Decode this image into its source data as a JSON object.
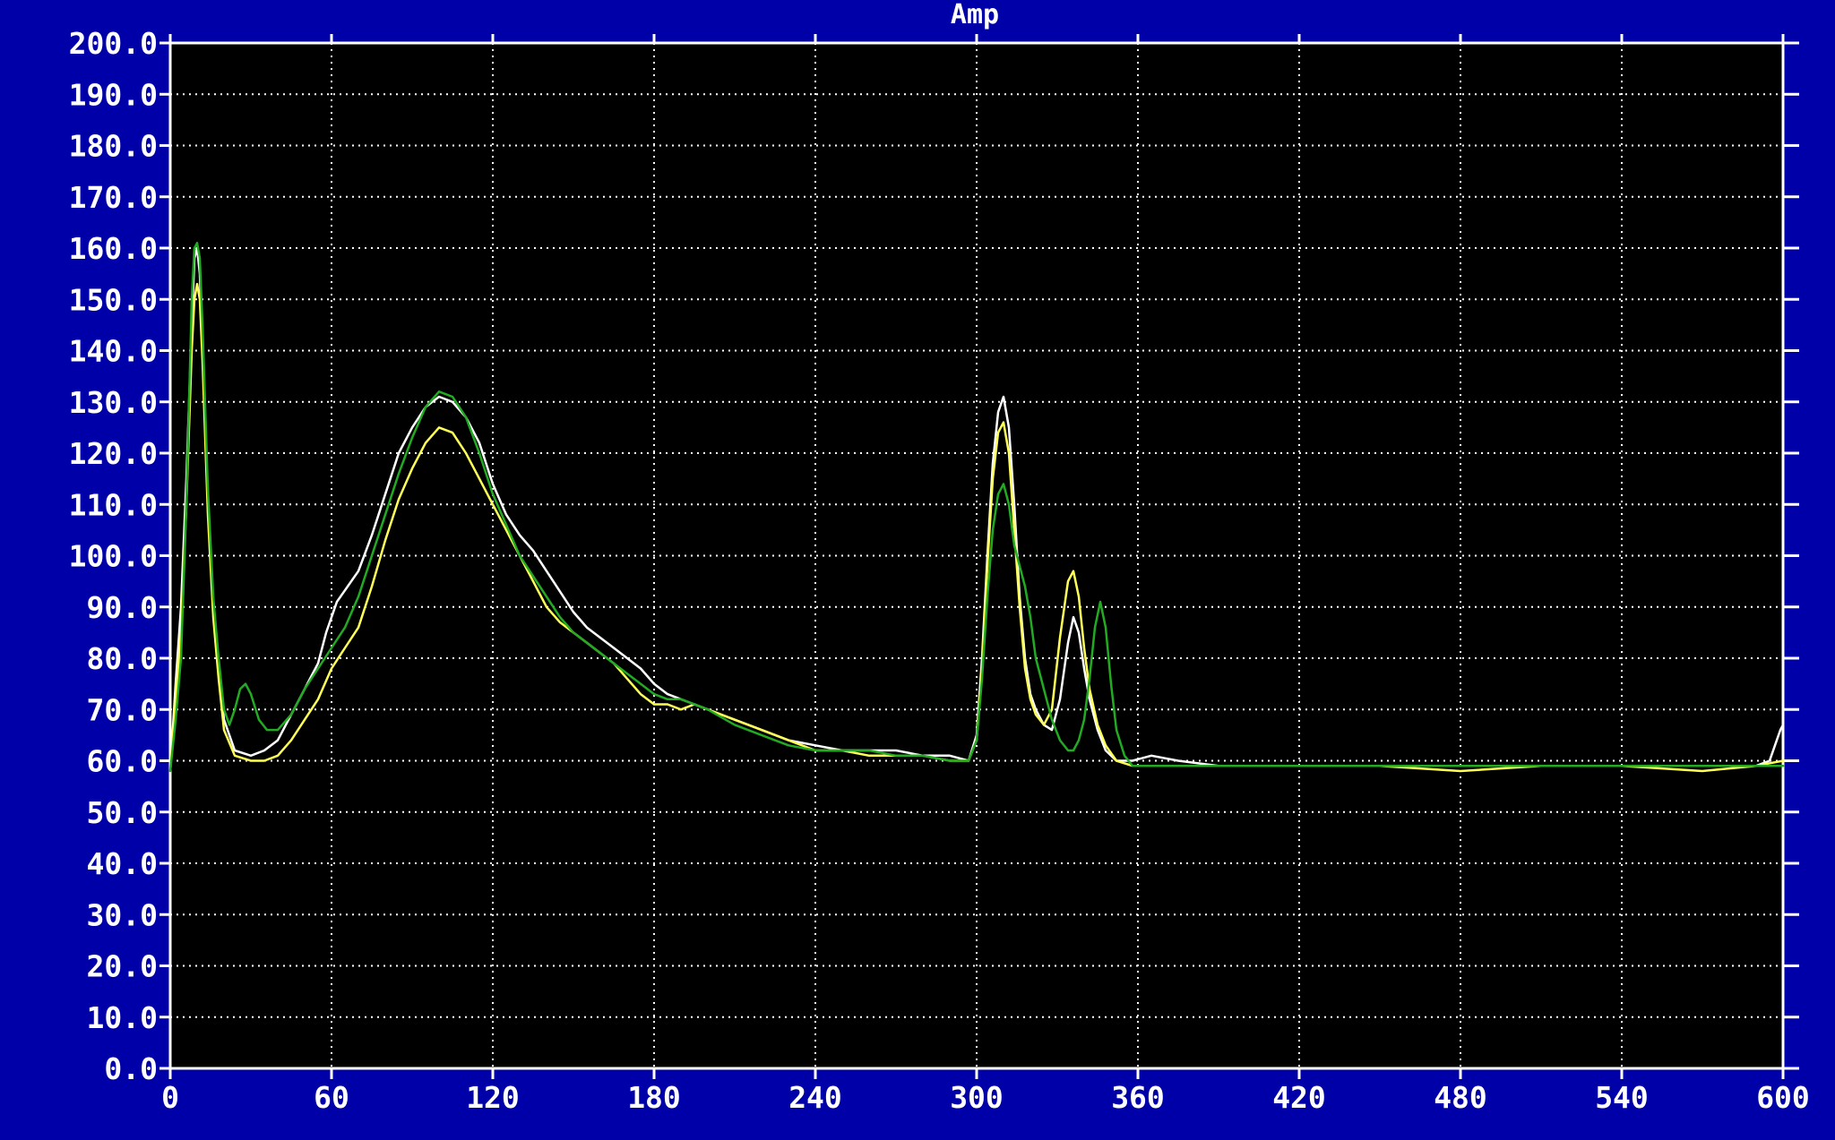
{
  "chart_data": {
    "type": "line",
    "title": "Amp",
    "xlabel": "",
    "ylabel": "",
    "xlim": [
      0,
      600
    ],
    "ylim": [
      0,
      200
    ],
    "xticks": [
      "0",
      "60",
      "120",
      "180",
      "240",
      "300",
      "360",
      "420",
      "480",
      "540",
      "600"
    ],
    "yticks": [
      "0.0",
      "10.0",
      "20.0",
      "30.0",
      "40.0",
      "50.0",
      "60.0",
      "70.0",
      "80.0",
      "90.0",
      "100.0",
      "110.0",
      "120.0",
      "130.0",
      "140.0",
      "150.0",
      "160.0",
      "170.0",
      "180.0",
      "190.0",
      "200.0"
    ],
    "grid": true,
    "colors": {
      "background": "#0000a8",
      "plot_area": "#000000",
      "grid": "#ffffff",
      "text": "#ffffff"
    },
    "series": [
      {
        "color": "#ffffff",
        "points": [
          [
            0,
            58
          ],
          [
            2,
            75
          ],
          [
            4,
            90
          ],
          [
            6,
            115
          ],
          [
            8,
            145
          ],
          [
            9,
            158
          ],
          [
            10,
            160
          ],
          [
            11,
            155
          ],
          [
            12,
            140
          ],
          [
            14,
            110
          ],
          [
            16,
            90
          ],
          [
            18,
            78
          ],
          [
            20,
            68
          ],
          [
            24,
            62
          ],
          [
            30,
            61
          ],
          [
            35,
            62
          ],
          [
            40,
            64
          ],
          [
            45,
            69
          ],
          [
            50,
            74
          ],
          [
            55,
            79
          ],
          [
            58,
            85
          ],
          [
            60,
            88
          ],
          [
            62,
            91
          ],
          [
            66,
            94
          ],
          [
            70,
            97
          ],
          [
            75,
            104
          ],
          [
            80,
            112
          ],
          [
            85,
            120
          ],
          [
            90,
            125
          ],
          [
            95,
            129
          ],
          [
            100,
            131
          ],
          [
            105,
            130
          ],
          [
            110,
            127
          ],
          [
            115,
            122
          ],
          [
            120,
            114
          ],
          [
            125,
            108
          ],
          [
            130,
            104
          ],
          [
            135,
            101
          ],
          [
            140,
            97
          ],
          [
            145,
            93
          ],
          [
            150,
            89
          ],
          [
            155,
            86
          ],
          [
            160,
            84
          ],
          [
            165,
            82
          ],
          [
            170,
            80
          ],
          [
            175,
            78
          ],
          [
            180,
            75
          ],
          [
            185,
            73
          ],
          [
            190,
            72
          ],
          [
            195,
            71
          ],
          [
            200,
            70
          ],
          [
            210,
            68
          ],
          [
            220,
            66
          ],
          [
            230,
            64
          ],
          [
            240,
            63
          ],
          [
            250,
            62
          ],
          [
            260,
            62
          ],
          [
            270,
            62
          ],
          [
            280,
            61
          ],
          [
            290,
            61
          ],
          [
            297,
            60
          ],
          [
            300,
            65
          ],
          [
            302,
            80
          ],
          [
            304,
            100
          ],
          [
            306,
            118
          ],
          [
            308,
            128
          ],
          [
            310,
            131
          ],
          [
            312,
            125
          ],
          [
            314,
            110
          ],
          [
            316,
            92
          ],
          [
            318,
            80
          ],
          [
            320,
            73
          ],
          [
            322,
            70
          ],
          [
            325,
            67
          ],
          [
            328,
            66
          ],
          [
            331,
            72
          ],
          [
            334,
            83
          ],
          [
            336,
            88
          ],
          [
            338,
            85
          ],
          [
            340,
            78
          ],
          [
            342,
            72
          ],
          [
            345,
            66
          ],
          [
            348,
            62
          ],
          [
            352,
            60
          ],
          [
            358,
            60
          ],
          [
            365,
            61
          ],
          [
            375,
            60
          ],
          [
            390,
            59
          ],
          [
            420,
            59
          ],
          [
            450,
            59
          ],
          [
            480,
            59
          ],
          [
            510,
            59
          ],
          [
            540,
            59
          ],
          [
            570,
            59
          ],
          [
            590,
            59
          ],
          [
            595,
            60
          ],
          [
            597,
            63
          ],
          [
            599,
            66
          ],
          [
            600,
            67
          ]
        ]
      },
      {
        "color": "#ffff55",
        "points": [
          [
            0,
            58
          ],
          [
            2,
            72
          ],
          [
            4,
            85
          ],
          [
            6,
            110
          ],
          [
            8,
            140
          ],
          [
            9,
            150
          ],
          [
            10,
            153
          ],
          [
            11,
            150
          ],
          [
            12,
            138
          ],
          [
            14,
            108
          ],
          [
            16,
            88
          ],
          [
            18,
            76
          ],
          [
            20,
            66
          ],
          [
            24,
            61
          ],
          [
            30,
            60
          ],
          [
            35,
            60
          ],
          [
            40,
            61
          ],
          [
            45,
            64
          ],
          [
            50,
            68
          ],
          [
            55,
            72
          ],
          [
            60,
            78
          ],
          [
            65,
            82
          ],
          [
            70,
            86
          ],
          [
            75,
            94
          ],
          [
            80,
            103
          ],
          [
            85,
            111
          ],
          [
            90,
            117
          ],
          [
            95,
            122
          ],
          [
            100,
            125
          ],
          [
            105,
            124
          ],
          [
            110,
            120
          ],
          [
            115,
            115
          ],
          [
            120,
            110
          ],
          [
            125,
            105
          ],
          [
            130,
            100
          ],
          [
            135,
            95
          ],
          [
            140,
            90
          ],
          [
            145,
            87
          ],
          [
            150,
            85
          ],
          [
            155,
            83
          ],
          [
            160,
            81
          ],
          [
            165,
            79
          ],
          [
            170,
            76
          ],
          [
            175,
            73
          ],
          [
            180,
            71
          ],
          [
            185,
            71
          ],
          [
            190,
            70
          ],
          [
            195,
            71
          ],
          [
            200,
            70
          ],
          [
            210,
            68
          ],
          [
            220,
            66
          ],
          [
            230,
            64
          ],
          [
            240,
            62
          ],
          [
            250,
            62
          ],
          [
            260,
            61
          ],
          [
            270,
            61
          ],
          [
            280,
            61
          ],
          [
            290,
            60
          ],
          [
            297,
            60
          ],
          [
            300,
            64
          ],
          [
            302,
            78
          ],
          [
            304,
            98
          ],
          [
            306,
            115
          ],
          [
            308,
            124
          ],
          [
            310,
            126
          ],
          [
            312,
            120
          ],
          [
            314,
            105
          ],
          [
            316,
            90
          ],
          [
            318,
            78
          ],
          [
            320,
            72
          ],
          [
            322,
            69
          ],
          [
            325,
            67
          ],
          [
            328,
            70
          ],
          [
            331,
            84
          ],
          [
            334,
            95
          ],
          [
            336,
            97
          ],
          [
            338,
            92
          ],
          [
            340,
            82
          ],
          [
            342,
            74
          ],
          [
            345,
            67
          ],
          [
            348,
            63
          ],
          [
            352,
            60
          ],
          [
            358,
            59
          ],
          [
            370,
            59
          ],
          [
            390,
            59
          ],
          [
            420,
            59
          ],
          [
            450,
            59
          ],
          [
            480,
            58
          ],
          [
            510,
            59
          ],
          [
            540,
            59
          ],
          [
            570,
            58
          ],
          [
            590,
            59
          ],
          [
            600,
            60
          ]
        ]
      },
      {
        "color": "#22aa22",
        "points": [
          [
            0,
            58
          ],
          [
            2,
            68
          ],
          [
            4,
            80
          ],
          [
            6,
            110
          ],
          [
            8,
            150
          ],
          [
            9,
            160
          ],
          [
            10,
            161
          ],
          [
            11,
            158
          ],
          [
            12,
            145
          ],
          [
            14,
            113
          ],
          [
            16,
            92
          ],
          [
            18,
            80
          ],
          [
            20,
            70
          ],
          [
            22,
            67
          ],
          [
            24,
            70
          ],
          [
            26,
            74
          ],
          [
            28,
            75
          ],
          [
            30,
            73
          ],
          [
            33,
            68
          ],
          [
            36,
            66
          ],
          [
            40,
            66
          ],
          [
            45,
            69
          ],
          [
            50,
            74
          ],
          [
            55,
            78
          ],
          [
            60,
            82
          ],
          [
            65,
            86
          ],
          [
            70,
            92
          ],
          [
            75,
            100
          ],
          [
            80,
            108
          ],
          [
            85,
            116
          ],
          [
            90,
            123
          ],
          [
            95,
            129
          ],
          [
            100,
            132
          ],
          [
            105,
            131
          ],
          [
            110,
            127
          ],
          [
            115,
            120
          ],
          [
            120,
            112
          ],
          [
            125,
            106
          ],
          [
            130,
            100
          ],
          [
            135,
            96
          ],
          [
            140,
            92
          ],
          [
            145,
            88
          ],
          [
            150,
            85
          ],
          [
            155,
            83
          ],
          [
            160,
            81
          ],
          [
            165,
            79
          ],
          [
            170,
            77
          ],
          [
            175,
            75
          ],
          [
            180,
            73
          ],
          [
            185,
            72
          ],
          [
            190,
            72
          ],
          [
            195,
            71
          ],
          [
            200,
            70
          ],
          [
            210,
            67
          ],
          [
            220,
            65
          ],
          [
            230,
            63
          ],
          [
            240,
            62
          ],
          [
            250,
            62
          ],
          [
            260,
            62
          ],
          [
            270,
            61
          ],
          [
            280,
            61
          ],
          [
            290,
            60
          ],
          [
            297,
            60
          ],
          [
            300,
            64
          ],
          [
            302,
            76
          ],
          [
            304,
            92
          ],
          [
            306,
            105
          ],
          [
            308,
            112
          ],
          [
            310,
            114
          ],
          [
            312,
            110
          ],
          [
            314,
            102
          ],
          [
            316,
            98
          ],
          [
            318,
            94
          ],
          [
            320,
            88
          ],
          [
            322,
            80
          ],
          [
            325,
            74
          ],
          [
            328,
            68
          ],
          [
            331,
            64
          ],
          [
            334,
            62
          ],
          [
            336,
            62
          ],
          [
            338,
            64
          ],
          [
            340,
            68
          ],
          [
            342,
            76
          ],
          [
            344,
            86
          ],
          [
            346,
            91
          ],
          [
            348,
            86
          ],
          [
            350,
            75
          ],
          [
            352,
            66
          ],
          [
            355,
            61
          ],
          [
            358,
            59
          ],
          [
            370,
            59
          ],
          [
            390,
            59
          ],
          [
            420,
            59
          ],
          [
            450,
            59
          ],
          [
            480,
            59
          ],
          [
            510,
            59
          ],
          [
            540,
            59
          ],
          [
            570,
            59
          ],
          [
            590,
            59
          ],
          [
            600,
            59
          ]
        ]
      }
    ]
  }
}
